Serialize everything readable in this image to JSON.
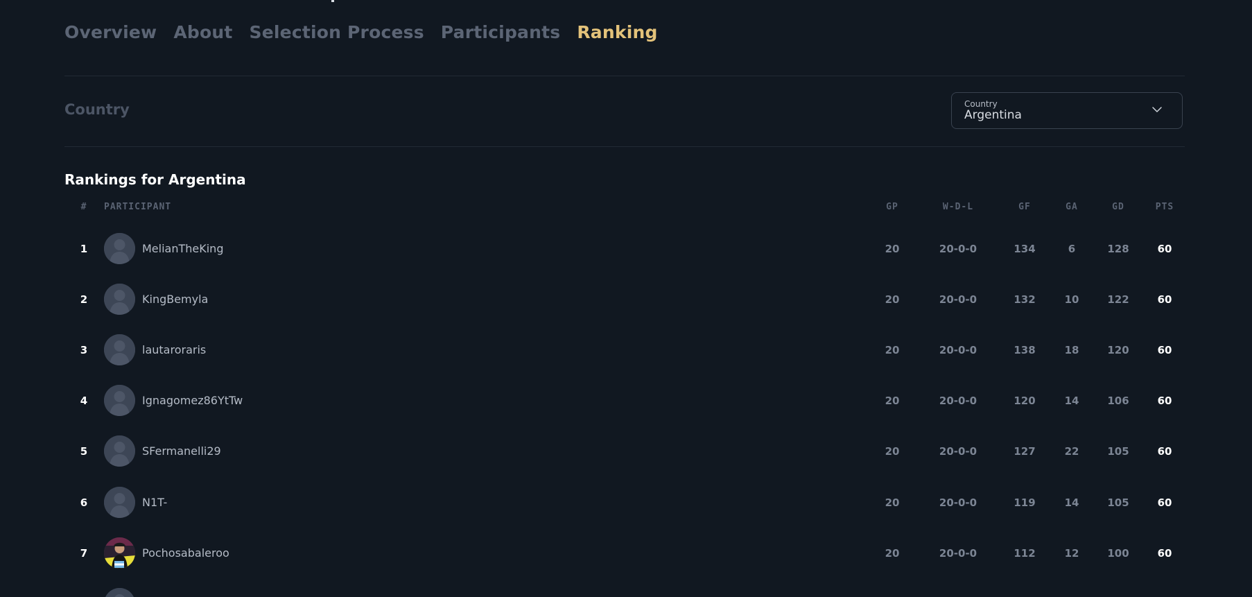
{
  "tabs": [
    {
      "label": "Overview",
      "active": false
    },
    {
      "label": "About",
      "active": false
    },
    {
      "label": "Selection Process",
      "active": false
    },
    {
      "label": "Participants",
      "active": false
    },
    {
      "label": "Ranking",
      "active": true
    }
  ],
  "filter": {
    "label": "Country",
    "select_label": "Country",
    "select_value": "Argentina",
    "icon": "chevron-down-icon"
  },
  "rankings_title": "Rankings for Argentina",
  "table": {
    "columns": [
      "#",
      "PARTICIPANT",
      "GP",
      "W-D-L",
      "GF",
      "GA",
      "GD",
      "PTS"
    ],
    "rows": [
      {
        "rank": "1",
        "name": "MelianTheKing",
        "gp": "20",
        "wdl": "20-0-0",
        "gf": "134",
        "ga": "6",
        "gd": "128",
        "pts": "60",
        "avatar": "default-avatar-icon"
      },
      {
        "rank": "2",
        "name": "KingBemyla",
        "gp": "20",
        "wdl": "20-0-0",
        "gf": "132",
        "ga": "10",
        "gd": "122",
        "pts": "60",
        "avatar": "default-avatar-icon"
      },
      {
        "rank": "3",
        "name": "lautaroraris",
        "gp": "20",
        "wdl": "20-0-0",
        "gf": "138",
        "ga": "18",
        "gd": "120",
        "pts": "60",
        "avatar": "default-avatar-icon"
      },
      {
        "rank": "4",
        "name": "Ignagomez86YtTw",
        "gp": "20",
        "wdl": "20-0-0",
        "gf": "120",
        "ga": "14",
        "gd": "106",
        "pts": "60",
        "avatar": "default-avatar-icon"
      },
      {
        "rank": "5",
        "name": "SFermanelli29",
        "gp": "20",
        "wdl": "20-0-0",
        "gf": "127",
        "ga": "22",
        "gd": "105",
        "pts": "60",
        "avatar": "default-avatar-icon"
      },
      {
        "rank": "6",
        "name": "N1T-",
        "gp": "20",
        "wdl": "20-0-0",
        "gf": "119",
        "ga": "14",
        "gd": "105",
        "pts": "60",
        "avatar": "default-avatar-icon"
      },
      {
        "rank": "7",
        "name": "Pochosabaleroo",
        "gp": "20",
        "wdl": "20-0-0",
        "gf": "112",
        "ga": "12",
        "gd": "100",
        "pts": "60",
        "avatar": "photo-avatar"
      }
    ]
  },
  "colors": {
    "background": "#111821",
    "active_tab": "#e3c27a",
    "inactive_tab": "#5c6575",
    "muted_text": "#7c8594"
  }
}
